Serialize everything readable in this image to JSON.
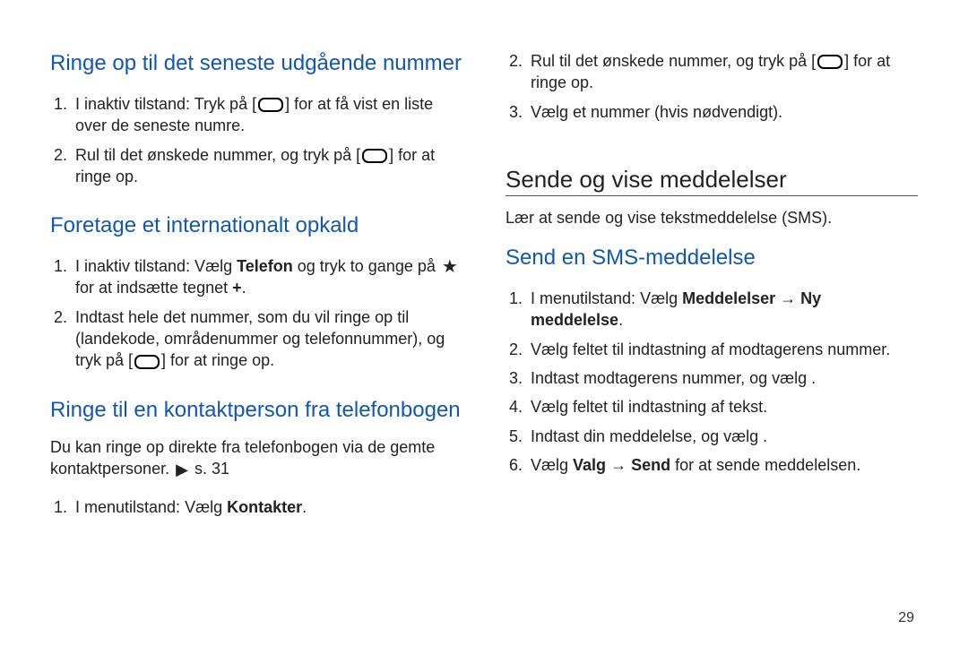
{
  "page_number": "29",
  "left": {
    "h1": "Ringe op til det seneste udgående nummer",
    "h1_list": [
      "I inaktiv tilstand: Tryk på [__CALL__] for at få vist en liste over de seneste numre.",
      "Rul til det ønskede nummer, og tryk på [__CALL__] for at ringe op."
    ],
    "h2": "Foretage et internationalt opkald",
    "h2_list": [
      "I inaktiv tilstand: Vælg __B__Telefon__/B__ og tryk to gange på __STAR__ for at indsætte tegnet __B__+__/B__.",
      "Indtast hele det nummer, som du vil ringe op til (landekode, områdenummer og telefonnummer), og tryk på [__CALL__] for at ringe op."
    ],
    "h3": "Ringe til en kontaktperson fra telefonbogen",
    "h3_body": "Du kan ringe op direkte fra telefonbogen via de gemte kontaktpersoner. __ARROW__ s. 31",
    "h3_list": [
      "I menutilstand: Vælg __B__Kontakter__/B__."
    ]
  },
  "right": {
    "top_list": [
      "Rul til det ønskede nummer, og tryk på [__CALL__] for at ringe op.",
      "Vælg et nummer (hvis nødvendigt)."
    ],
    "section": "Sende og vise meddelelser",
    "section_body": "Lær at sende og vise tekstmeddelelse (SMS).",
    "h1": "Send en SMS-meddelelse",
    "h1_list": [
      "I menutilstand: Vælg __B__Meddelelser__/B__ → __B__Ny meddelelse__/B__.",
      "Vælg feltet til indtastning af modtagerens nummer.",
      "Indtast modtagerens nummer, og vælg       .",
      "Vælg feltet til indtastning af tekst.",
      "Indtast din meddelelse, og vælg       .",
      "Vælg __B__Valg__/B__ → __B__Send__/B__ for at sende meddelelsen."
    ]
  }
}
